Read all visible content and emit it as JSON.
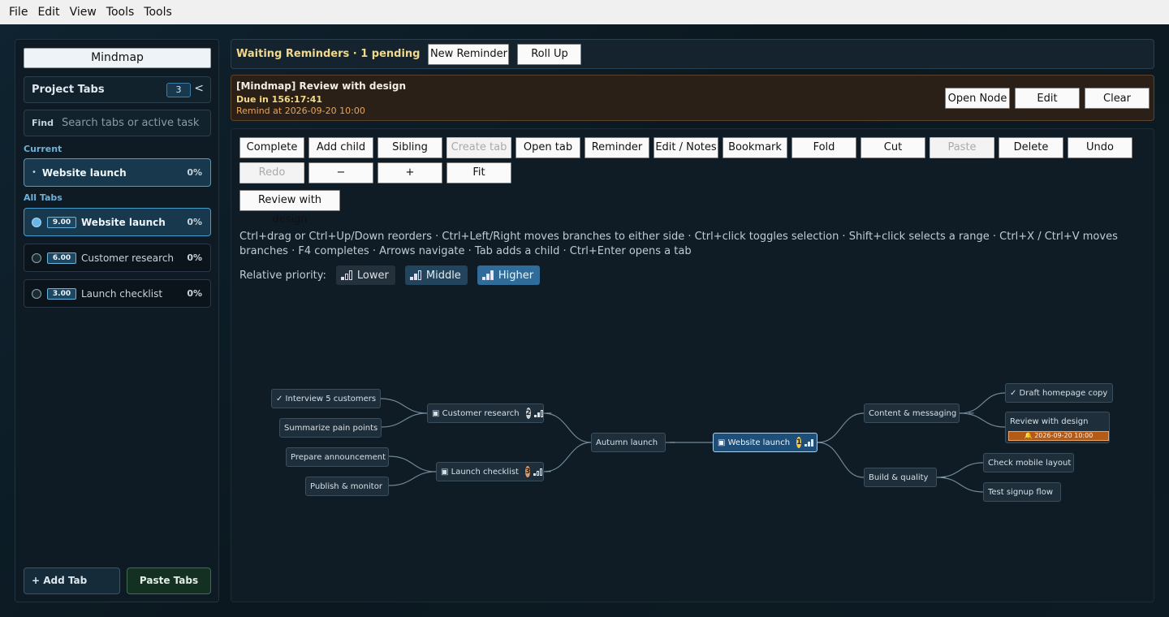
{
  "menu": [
    "File",
    "Edit",
    "View",
    "Tools",
    "Tools"
  ],
  "sidebar": {
    "title": "Mindmap",
    "project_tabs_label": "Project Tabs",
    "tab_count": "3",
    "collapse_glyph": "<",
    "find_label": "Find",
    "find_placeholder": "Search tabs or active task",
    "current_label": "Current",
    "current": {
      "name": "Website launch",
      "pct": "0%"
    },
    "all_tabs_label": "All Tabs",
    "tabs": [
      {
        "priority": "9.00",
        "name": "Website launch",
        "pct": "0%",
        "active": true
      },
      {
        "priority": "6.00",
        "name": "Customer research",
        "pct": "0%",
        "active": false
      },
      {
        "priority": "3.00",
        "name": "Launch checklist",
        "pct": "0%",
        "active": false
      }
    ],
    "add_tab": "+ Add Tab",
    "paste_tabs": "Paste Tabs"
  },
  "reminders": {
    "title": "Waiting Reminders · 1 pending",
    "new_reminder": "New Reminder",
    "roll_up": "Roll Up",
    "card": {
      "title": "[Mindmap] Review with design",
      "due": "Due in 156:17:41",
      "remind_at": "Remind at 2026-09-20 10:00",
      "open_node": "Open Node",
      "edit": "Edit",
      "clear": "Clear"
    }
  },
  "toolbar": {
    "row1": [
      {
        "label": "Complete",
        "disabled": false
      },
      {
        "label": "Add child",
        "disabled": false
      },
      {
        "label": "Sibling",
        "disabled": false
      },
      {
        "label": "Create tab",
        "disabled": true
      },
      {
        "label": "Open tab",
        "disabled": false
      },
      {
        "label": "Reminder",
        "disabled": false
      },
      {
        "label": "Edit / Notes",
        "disabled": false
      },
      {
        "label": "Bookmark",
        "disabled": false
      },
      {
        "label": "Fold",
        "disabled": false
      },
      {
        "label": "Cut",
        "disabled": false
      },
      {
        "label": "Paste",
        "disabled": true
      },
      {
        "label": "Delete",
        "disabled": false
      },
      {
        "label": "Undo",
        "disabled": false
      }
    ],
    "row2": [
      {
        "label": "Redo",
        "disabled": true
      },
      {
        "label": "−",
        "disabled": false
      },
      {
        "label": "+",
        "disabled": false
      },
      {
        "label": "Fit",
        "disabled": false
      }
    ],
    "selected_node": "Review with design"
  },
  "hint": "Ctrl+drag or Ctrl+Up/Down reorders · Ctrl+Left/Right moves branches to either side · Ctrl+click toggles selection · Shift+click selects a range · Ctrl+X / Ctrl+V moves branches · F4 completes · Arrows navigate · Tab adds a child · Ctrl+Enter opens a tab",
  "priority": {
    "label": "Relative priority:",
    "lower": "Lower",
    "middle": "Middle",
    "higher": "Higher"
  },
  "mindmap": {
    "root": "Autumn launch",
    "customer_research": "▣ Customer research",
    "customer_research_badge": "2",
    "interview": "✓ Interview 5 customers",
    "summarize": "Summarize pain points",
    "launch_checklist": "▣ Launch checklist",
    "launch_checklist_badge": "3",
    "prepare": "Prepare announcement",
    "publish": "Publish & monitor",
    "website_launch": "▣ Website launch",
    "website_launch_badge": "1",
    "content": "Content & messaging",
    "draft": "✓ Draft homepage copy",
    "review": "Review with design",
    "review_chip": "🔔 2026-09-20 10:00",
    "build": "Build & quality",
    "mobile": "Check mobile layout",
    "signup": "Test signup flow",
    "fold_glyph": "−",
    "colors": {
      "selected": "#1f4f78",
      "badge1": "#f2c94c",
      "badge2": "#c9d3da",
      "badge3": "#e39a63",
      "chip": "#b45a17"
    }
  }
}
